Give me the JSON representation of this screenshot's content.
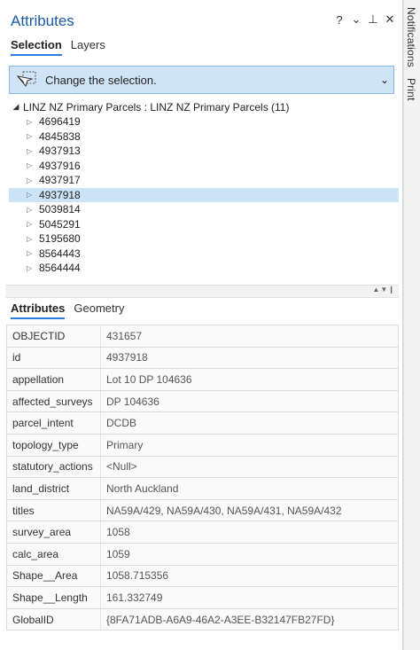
{
  "pane": {
    "title": "Attributes",
    "controls": {
      "help": "?",
      "dropdown": "⌄",
      "pin": "⊥",
      "close": "✕"
    }
  },
  "side_tabs": {
    "notifications": "Notifications",
    "print": "Print"
  },
  "top_tabs": {
    "selection": "Selection",
    "layers": "Layers"
  },
  "change_selection": {
    "label": "Change the selection."
  },
  "tree": {
    "root_label": "LINZ NZ Primary Parcels : LINZ NZ Primary Parcels (11)",
    "items": [
      "4696419",
      "4845838",
      "4937913",
      "4937916",
      "4937917",
      "4937918",
      "5039814",
      "5045291",
      "5195680",
      "8564443",
      "8564444"
    ],
    "selected": "4937918"
  },
  "bottom_tabs": {
    "attributes": "Attributes",
    "geometry": "Geometry"
  },
  "attributes": [
    {
      "field": "OBJECTID",
      "value": "431657"
    },
    {
      "field": "id",
      "value": "4937918"
    },
    {
      "field": "appellation",
      "value": "Lot 10 DP 104636"
    },
    {
      "field": "affected_surveys",
      "value": "DP 104636"
    },
    {
      "field": "parcel_intent",
      "value": "DCDB"
    },
    {
      "field": "topology_type",
      "value": "Primary"
    },
    {
      "field": "statutory_actions",
      "value": "<Null>"
    },
    {
      "field": "land_district",
      "value": "North Auckland"
    },
    {
      "field": "titles",
      "value": "NA59A/429, NA59A/430, NA59A/431, NA59A/432"
    },
    {
      "field": "survey_area",
      "value": "1058"
    },
    {
      "field": "calc_area",
      "value": "1059"
    },
    {
      "field": "Shape__Area",
      "value": "1058.715356"
    },
    {
      "field": "Shape__Length",
      "value": "161.332749"
    },
    {
      "field": "GlobalID",
      "value": "{8FA71ADB-A6A9-46A2-A3EE-B32147FB27FD}"
    }
  ],
  "colors": {
    "accent": "#2a7de1",
    "title": "#1e5aa8",
    "selected_row": "#cde3f7",
    "bar": "#cfe5f7"
  }
}
